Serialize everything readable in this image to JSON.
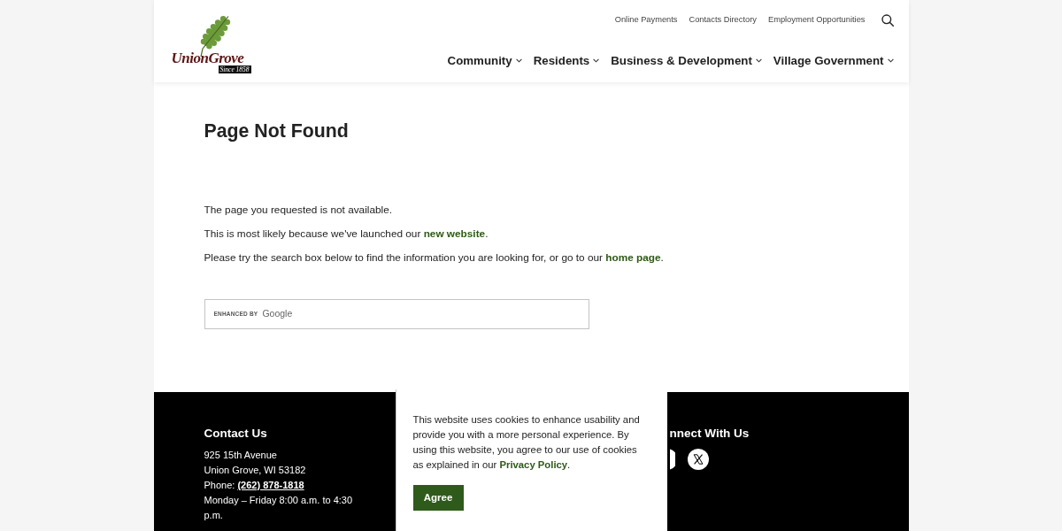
{
  "header": {
    "logo": {
      "wordmark": "UnionGrove",
      "tagline": "Since 1858"
    },
    "utility_links": [
      "Online Payments",
      "Contacts Directory",
      "Employment Opportunities"
    ],
    "nav": [
      {
        "label": "Community"
      },
      {
        "label": "Residents"
      },
      {
        "label": "Business & Development"
      },
      {
        "label": "Village Government"
      }
    ]
  },
  "main": {
    "title": "Page Not Found",
    "paragraphs": [
      {
        "text": "The page you requested is not available."
      },
      {
        "text": "This is most likely because we've launched our ",
        "link": "new website",
        "after": "."
      },
      {
        "text": "Please try the search box below to find the information you are looking for, or go to our ",
        "link": "home page",
        "after": "."
      }
    ],
    "search": {
      "prefix": "ENHANCED BY",
      "brand": "Google"
    }
  },
  "footer": {
    "contact": {
      "heading": "Contact Us",
      "address": [
        "925 15th Avenue",
        "Union Grove, WI 53182"
      ],
      "phone": {
        "label": "Phone: ",
        "number": "(262) 878-1818"
      },
      "hours": "Monday – Friday 8:00 a.m. to 4:30 p.m."
    },
    "connect": {
      "heading": "nnect With Us"
    }
  },
  "cookie_banner": {
    "text": "This website uses cookies to enhance usability and provide you with a more personal experience. By using this website, you agree to our use of cookies as explained in our ",
    "link": "Privacy Policy",
    "after": ".",
    "button": "Agree"
  }
}
